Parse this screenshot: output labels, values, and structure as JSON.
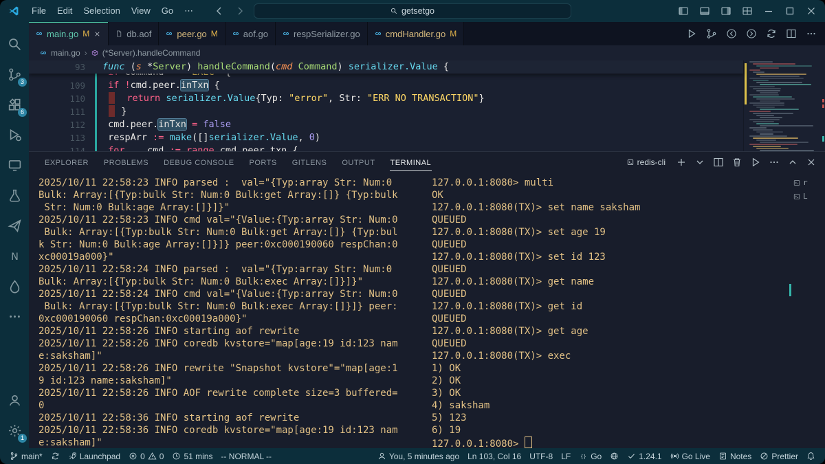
{
  "colors": {
    "accent_teal": "#4ec9a5",
    "modified_yellow": "#e2b34a",
    "terminal_text": "#e2c185",
    "badge_blue": "#2e86a5"
  },
  "titlebar": {
    "menus": [
      "File",
      "Edit",
      "Selection",
      "View",
      "Go",
      "⋯"
    ],
    "search_value": "getsetgo"
  },
  "titlebar_right": [
    {
      "name": "copilot-button",
      "icon": "copilot",
      "chev": true,
      "spacer": true
    },
    {
      "name": "toggle-sidebar-left-button",
      "icon": "layoutL"
    },
    {
      "name": "toggle-panel-button",
      "icon": "layoutP"
    },
    {
      "name": "toggle-sidebar-right-button",
      "icon": "layoutR"
    },
    {
      "name": "customize-layout-button",
      "icon": "layoutG"
    },
    {
      "name": "window-minimize-button",
      "icon": "winmin"
    },
    {
      "name": "window-maximize-button",
      "icon": "winmax"
    },
    {
      "name": "window-close-button",
      "icon": "winclose"
    }
  ],
  "activity_bar": {
    "top": [
      {
        "name": "search-icon",
        "icon": "search"
      },
      {
        "name": "source-control-icon",
        "icon": "scm",
        "badge": "3"
      },
      {
        "name": "extensions-icon",
        "icon": "extensions",
        "badge": "6"
      },
      {
        "name": "run-debug-icon",
        "icon": "debug"
      },
      {
        "name": "remote-explorer-icon",
        "icon": "monitor"
      },
      {
        "name": "testing-icon",
        "icon": "beaker"
      },
      {
        "name": "share-icon",
        "icon": "send"
      },
      {
        "name": "notes-extension-icon",
        "icon": "letterN"
      },
      {
        "name": "ink-icon",
        "icon": "droplet"
      },
      {
        "name": "more-views-icon",
        "icon": "more"
      }
    ],
    "bottom": [
      {
        "name": "accounts-icon",
        "icon": "account"
      },
      {
        "name": "settings-gear-icon",
        "icon": "gear",
        "badge": "1"
      }
    ]
  },
  "editor_tabs": [
    {
      "label": "main.go",
      "icon": "go",
      "modified": true,
      "active": true,
      "show_close": true
    },
    {
      "label": "db.aof",
      "icon": "file"
    },
    {
      "label": "peer.go",
      "icon": "go",
      "modified": true
    },
    {
      "label": "aof.go",
      "icon": "go"
    },
    {
      "label": "respSerializer.go",
      "icon": "go"
    },
    {
      "label": "cmdHandler.go",
      "icon": "go",
      "modified": true
    }
  ],
  "editor_actions": [
    {
      "name": "run-button",
      "icon": "play"
    },
    {
      "name": "git-compare-button",
      "icon": "scm"
    },
    {
      "name": "nav-back-button",
      "icon": "navback"
    },
    {
      "name": "nav-forward-button",
      "icon": "navfwd"
    },
    {
      "name": "sync-file-button",
      "icon": "sync"
    },
    {
      "name": "split-editor-button",
      "icon": "split"
    },
    {
      "name": "editor-more-button",
      "icon": "more"
    }
  ],
  "breadcrumb": {
    "file": "main.go",
    "symbol": "(*Server).handleCommand"
  },
  "code": {
    "sticky": {
      "num": "93",
      "tokens": [
        [
          "func ",
          "kw2"
        ],
        [
          "(",
          "pl"
        ],
        [
          "s",
          "param"
        ],
        [
          " *",
          "pl"
        ],
        [
          "Server",
          "type2"
        ],
        [
          ") ",
          "pl"
        ],
        [
          "handleCommand",
          "fn"
        ],
        [
          "(",
          "pl"
        ],
        [
          "cmd",
          "param"
        ],
        [
          " ",
          "pl"
        ],
        [
          "Command",
          "type2"
        ],
        [
          ") ",
          "pl"
        ],
        [
          "serializer.Value",
          "type"
        ],
        [
          " {",
          "pl"
        ]
      ]
    },
    "partial_top": {
      "num": "",
      "tokens": [
        [
          " ",
          "pl"
        ],
        [
          "if ",
          "kw"
        ],
        [
          "command ",
          "pl"
        ],
        [
          "== ",
          "op"
        ],
        [
          "\"EXEC\"",
          "str"
        ],
        [
          " {",
          "pl"
        ]
      ]
    },
    "lines": [
      {
        "num": "109",
        "tokens": [
          [
            " ",
            "pl"
          ],
          [
            "if ",
            "kw"
          ],
          [
            "!",
            "op"
          ],
          [
            "cmd.peer.",
            "pl"
          ],
          [
            "inTxn",
            "hl"
          ],
          [
            " {",
            "pl"
          ]
        ]
      },
      {
        "num": "110",
        "tokens": [
          [
            " ",
            "pl"
          ],
          [
            "",
            "red"
          ],
          [
            "  ",
            "pl"
          ],
          [
            "return ",
            "kw"
          ],
          [
            "serializer.Value",
            "type"
          ],
          [
            "{",
            "pl"
          ],
          [
            "Typ: ",
            "pl"
          ],
          [
            "\"error\"",
            "str"
          ],
          [
            ", ",
            "pl"
          ],
          [
            "Str: ",
            "pl"
          ],
          [
            "\"ERR NO TRANSACTION\"",
            "str"
          ],
          [
            "}",
            "pl"
          ]
        ]
      },
      {
        "num": "111",
        "tokens": [
          [
            " ",
            "pl"
          ],
          [
            "",
            "red"
          ],
          [
            " }",
            "pl"
          ]
        ]
      },
      {
        "num": "112",
        "tokens": [
          [
            " ",
            "pl"
          ],
          [
            "cmd.peer.",
            "pl"
          ],
          [
            "inTxn",
            "hl"
          ],
          [
            " = ",
            "op"
          ],
          [
            "false",
            "num"
          ]
        ]
      },
      {
        "num": "113",
        "tokens": [
          [
            " ",
            "pl"
          ],
          [
            "respArr ",
            "pl"
          ],
          [
            ":= ",
            "op"
          ],
          [
            "make",
            "type"
          ],
          [
            "([]",
            "pl"
          ],
          [
            "serializer.Value",
            "type"
          ],
          [
            ", ",
            "pl"
          ],
          [
            "0",
            "num"
          ],
          [
            ")",
            "pl"
          ]
        ]
      }
    ],
    "partial_bottom": {
      "num": "114",
      "tokens": [
        [
          " ",
          "pl"
        ],
        [
          "for ",
          "kw"
        ],
        [
          "_, cmd ",
          "pl"
        ],
        [
          ":= ",
          "op"
        ],
        [
          "range",
          "kw"
        ],
        [
          " cmd.peer.txn {",
          "pl"
        ]
      ]
    }
  },
  "panel": {
    "tabs": [
      "EXPLORER",
      "PROBLEMS",
      "DEBUG CONSOLE",
      "PORTS",
      "GITLENS",
      "OUTPUT",
      "TERMINAL"
    ],
    "active_tab": "TERMINAL",
    "terminal_profile": "redis-cli",
    "actions": [
      {
        "name": "new-terminal-button",
        "icon": "plus"
      },
      {
        "name": "terminal-profile-dropdown",
        "icon": "chevdown"
      },
      {
        "name": "split-terminal-button",
        "icon": "split"
      },
      {
        "name": "kill-terminal-button",
        "icon": "trash"
      },
      {
        "name": "run-task-button",
        "icon": "play"
      },
      {
        "name": "terminal-more-button",
        "icon": "more"
      },
      {
        "name": "maximize-panel-button",
        "icon": "chevup"
      },
      {
        "name": "close-panel-button",
        "icon": "close"
      }
    ],
    "terminal_list": [
      {
        "label": "r"
      },
      {
        "label": "L"
      }
    ]
  },
  "terminal": {
    "left_rows": [
      "2025/10/11 22:58:23 INFO parsed :  val=\"{Typ:array Str: Num:0",
      "Bulk: Array:[{Typ:bulk Str: Num:0 Bulk:get Array:[]} {Typ:bulk",
      " Str: Num:0 Bulk:age Array:[]}]}\"",
      "2025/10/11 22:58:23 INFO cmd val=\"{Value:{Typ:array Str: Num:0",
      " Bulk: Array:[{Typ:bulk Str: Num:0 Bulk:get Array:[]} {Typ:bul",
      "k Str: Num:0 Bulk:age Array:[]}]} peer:0xc000190060 respChan:0",
      "xc00019a000}\"",
      "2025/10/11 22:58:24 INFO parsed :  val=\"{Typ:array Str: Num:0",
      "Bulk: Array:[{Typ:bulk Str: Num:0 Bulk:exec Array:[]}]}\"",
      "2025/10/11 22:58:24 INFO cmd val=\"{Value:{Typ:array Str: Num:0",
      " Bulk: Array:[{Typ:bulk Str: Num:0 Bulk:exec Array:[]}]} peer:",
      "0xc000190060 respChan:0xc00019a000}\"",
      "2025/10/11 22:58:26 INFO starting aof rewrite",
      "2025/10/11 22:58:26 INFO coredb kvstore=\"map[age:19 id:123 nam",
      "e:saksham]\"",
      "2025/10/11 22:58:26 INFO rewrite \"Snapshot kvstore\"=\"map[age:1",
      "9 id:123 name:saksham]\"",
      "2025/10/11 22:58:26 INFO AOF rewrite complete size=3 buffered=",
      "0",
      "2025/10/11 22:58:36 INFO starting aof rewrite",
      "2025/10/11 22:58:36 INFO coredb kvstore=\"map[age:19 id:123 nam",
      "e:saksham]\""
    ],
    "right_rows": [
      "127.0.0.1:8080> multi",
      "OK",
      "127.0.0.1:8080(TX)> set name saksham",
      "QUEUED",
      "127.0.0.1:8080(TX)> set age 19",
      "QUEUED",
      "127.0.0.1:8080(TX)> set id 123",
      "QUEUED",
      "127.0.0.1:8080(TX)> get name",
      "QUEUED",
      "127.0.0.1:8080(TX)> get id",
      "QUEUED",
      "127.0.0.1:8080(TX)> get age",
      "QUEUED",
      "127.0.0.1:8080(TX)> exec",
      "1) OK",
      "2) OK",
      "3) OK",
      "4) saksham",
      "5) 123",
      "6) 19"
    ],
    "prompt_row": "127.0.0.1:8080> "
  },
  "statusbar": {
    "left": [
      {
        "name": "git-branch-status",
        "icon": "branch",
        "label": "main*"
      },
      {
        "name": "sync-changes-button",
        "icon": "sync"
      },
      {
        "name": "launchpad-status",
        "icon": "rocket",
        "label": "Launchpad"
      },
      {
        "name": "problems-status",
        "icon": "err",
        "label": "0",
        "icon2": "warn",
        "label2": "0"
      },
      {
        "name": "time-tracker-status",
        "icon": "clock",
        "label": "51 mins"
      },
      {
        "name": "vim-mode-status",
        "label": "-- NORMAL --"
      }
    ],
    "right": [
      {
        "name": "gitlens-blame-status",
        "icon": "account",
        "label": "You, 5 minutes ago"
      },
      {
        "name": "cursor-position-status",
        "label": "Ln 103, Col 16"
      },
      {
        "name": "encoding-status",
        "label": "UTF-8"
      },
      {
        "name": "eol-status",
        "label": "LF"
      },
      {
        "name": "language-status",
        "icon": "braces",
        "label": "Go"
      },
      {
        "name": "go-tools-status",
        "icon": "globe"
      },
      {
        "name": "go-version-status",
        "icon": "check",
        "label": "1.24.1"
      },
      {
        "name": "go-live-button",
        "icon": "broadcast",
        "label": "Go Live"
      },
      {
        "name": "notes-button",
        "icon": "note",
        "label": "Notes"
      },
      {
        "name": "prettier-status",
        "icon": "slash",
        "label": "Prettier"
      },
      {
        "name": "notifications-bell",
        "icon": "bell"
      }
    ]
  }
}
